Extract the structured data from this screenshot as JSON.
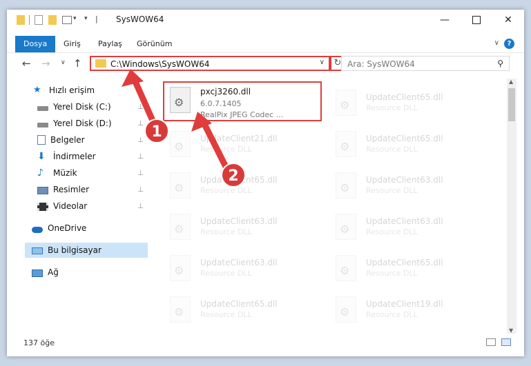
{
  "window": {
    "title": "SysWOW64"
  },
  "ribbon": {
    "tabs": [
      "Dosya",
      "Giriş",
      "Paylaş",
      "Görünüm"
    ],
    "help": "?"
  },
  "nav": {
    "address": "C:\\Windows\\SysWOW64",
    "search_placeholder": "Ara: SysWOW64"
  },
  "sidebar": {
    "items": [
      {
        "label": "Hızlı erişim",
        "icon": "star-icon",
        "pinned": false
      },
      {
        "label": "Yerel Disk (C:)",
        "icon": "drive-icon",
        "pinned": true
      },
      {
        "label": "Yerel Disk (D:)",
        "icon": "drive-icon",
        "pinned": true
      },
      {
        "label": "Belgeler",
        "icon": "documents-icon",
        "pinned": true
      },
      {
        "label": "İndirmeler",
        "icon": "download-icon",
        "pinned": true
      },
      {
        "label": "Müzik",
        "icon": "music-icon",
        "pinned": true
      },
      {
        "label": "Resimler",
        "icon": "pictures-icon",
        "pinned": true
      },
      {
        "label": "Videolar",
        "icon": "video-icon",
        "pinned": true
      },
      {
        "label": "OneDrive",
        "icon": "cloud-icon",
        "pinned": false
      },
      {
        "label": "Bu bilgisayar",
        "icon": "computer-icon",
        "pinned": false
      },
      {
        "label": "Ağ",
        "icon": "network-icon",
        "pinned": false
      }
    ]
  },
  "files": {
    "highlighted": {
      "name": "pxcj3260.dll",
      "version": "6.0.7.1405",
      "description": "RealPix JPEG Codec ..."
    },
    "left_column": [
      {
        "name": "UpdateClient21.dll",
        "description": "Resource DLL"
      },
      {
        "name": "UpdateClient65.dll",
        "description": "Resource DLL"
      },
      {
        "name": "UpdateClient63.dll",
        "description": "Resource DLL"
      },
      {
        "name": "UpdateClient63.dll",
        "description": "Resource DLL"
      },
      {
        "name": "UpdateClient65.dll",
        "description": "Resource DLL"
      }
    ],
    "right_column": [
      {
        "name": "UpdateClient65.dll",
        "description": "Resource DLL"
      },
      {
        "name": "UpdateClient65.dll",
        "description": "Resource DLL"
      },
      {
        "name": "UpdateClient63.dll",
        "description": "Resource DLL"
      },
      {
        "name": "UpdateClient63.dll",
        "description": "Resource DLL"
      },
      {
        "name": "UpdateClient65.dll",
        "description": "Resource DLL"
      },
      {
        "name": "UpdateClient19.dll",
        "description": "Resource DLL"
      }
    ]
  },
  "status": {
    "count": "137 öğe"
  },
  "annotations": {
    "badge1": "1",
    "badge2": "2",
    "accent": "#e03c3c"
  }
}
